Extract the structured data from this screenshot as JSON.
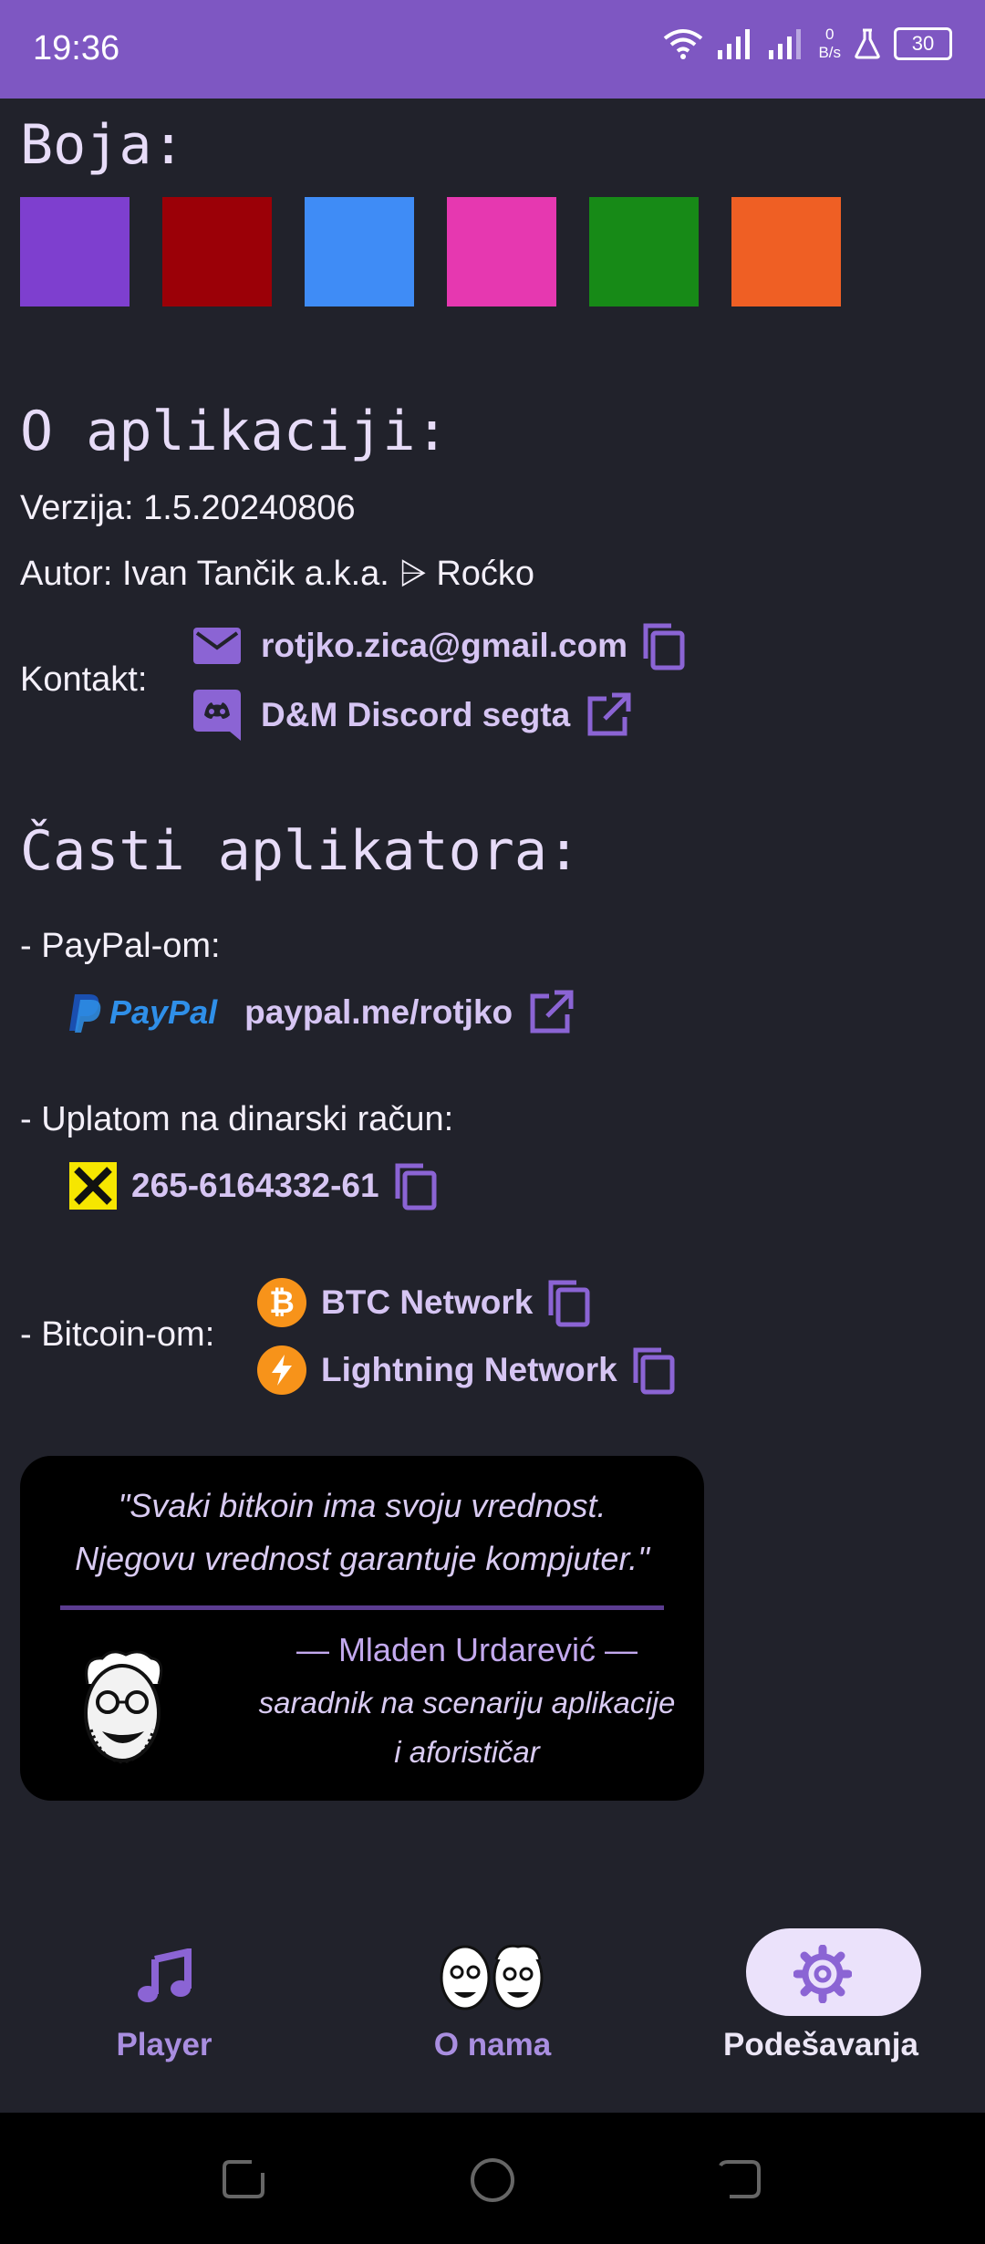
{
  "status_bar": {
    "time": "19:36",
    "net_speed_value": "0",
    "net_speed_unit": "B/s",
    "battery": "30"
  },
  "color_section": {
    "title": "Boja:",
    "swatches": [
      "#7e3fcf",
      "#9b0007",
      "#3f8cf6",
      "#e638b0",
      "#178a17",
      "#ef5f24"
    ]
  },
  "about": {
    "title": "O aplikaciji:",
    "version": "Verzija: 1.5.20240806",
    "author": "Autor:  Ivan Tančik a.k.a. ⩥ Roćko",
    "contact_label": "Kontakt:",
    "email": "rotjko.zica@gmail.com",
    "discord": "D&M Discord segta"
  },
  "donate": {
    "title": "Časti aplikatora:",
    "paypal_label": "- PayPal-om:",
    "paypal_brand": "PayPal",
    "paypal_link": "paypal.me/rotjko",
    "bank_label": "- Uplatom na dinarski račun:",
    "bank_account": "265-6164332-61",
    "bitcoin_label": "- Bitcoin-om:",
    "btc_network": "BTC Network",
    "lightning_network": "Lightning Network"
  },
  "quote": {
    "line1": "\"Svaki bitkoin ima svoju vrednost.",
    "line2": "Njegovu vrednost garantuje kompjuter.\"",
    "author": "— Mladen Urdarević —",
    "role_line1": "saradnik na scenariju aplikacije",
    "role_line2": "i aforističar"
  },
  "bottom_nav": {
    "player": "Player",
    "o_nama": "O nama",
    "settings": "Podešavanja"
  },
  "colors": {
    "accent": "#7e57c2",
    "background": "#21222b",
    "link": "#d6c5f3",
    "active_pill": "#ebe2fb"
  }
}
